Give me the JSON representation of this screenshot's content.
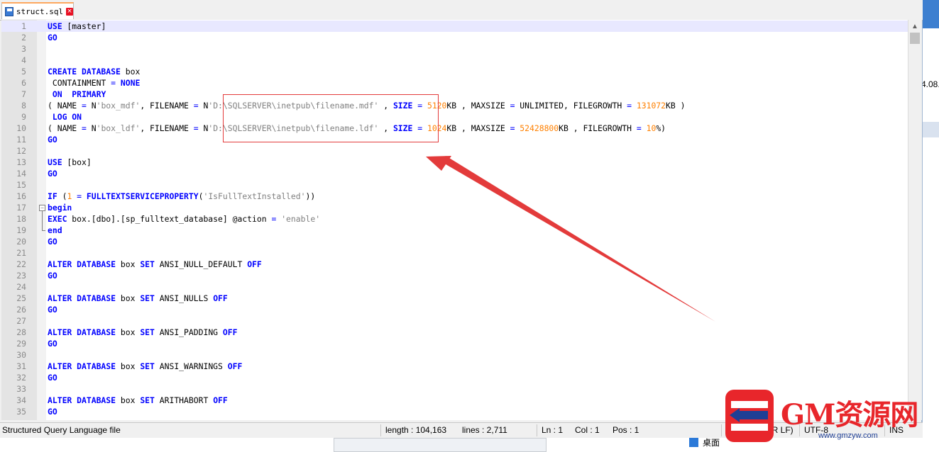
{
  "tab": {
    "title": "struct.sql",
    "close_symbol": "×"
  },
  "editor": {
    "lines": [
      {
        "n": "1",
        "cur": true,
        "parts": [
          [
            "k",
            "USE"
          ],
          [
            "v",
            " [master]"
          ]
        ]
      },
      {
        "n": "2",
        "parts": [
          [
            "k",
            "GO"
          ]
        ]
      },
      {
        "n": "3",
        "parts": []
      },
      {
        "n": "4",
        "parts": []
      },
      {
        "n": "5",
        "parts": [
          [
            "k",
            "CREATE DATABASE"
          ],
          [
            "v",
            " box"
          ]
        ]
      },
      {
        "n": "6",
        "parts": [
          [
            "v",
            " CONTAINMENT "
          ],
          [
            "o",
            "="
          ],
          [
            "v",
            " "
          ],
          [
            "k",
            "NONE"
          ]
        ]
      },
      {
        "n": "7",
        "parts": [
          [
            "v",
            " "
          ],
          [
            "k",
            "ON"
          ],
          [
            "v",
            "  "
          ],
          [
            "k",
            "PRIMARY"
          ]
        ]
      },
      {
        "n": "8",
        "parts": [
          [
            "v",
            "( NAME "
          ],
          [
            "o",
            "="
          ],
          [
            "v",
            " N"
          ],
          [
            "s",
            "'box_mdf'"
          ],
          [
            "v",
            ", FILENAME "
          ],
          [
            "o",
            "="
          ],
          [
            "v",
            " N"
          ],
          [
            "s",
            "'D:\\SQLSERVER\\inetpub\\filename.mdf'"
          ],
          [
            "v",
            " , "
          ],
          [
            "k",
            "SIZE"
          ],
          [
            "v",
            " "
          ],
          [
            "o",
            "="
          ],
          [
            "v",
            " "
          ],
          [
            "n",
            "5120"
          ],
          [
            "v",
            "KB , MAXSIZE "
          ],
          [
            "o",
            "="
          ],
          [
            "v",
            " UNLIMITED, FILEGROWTH "
          ],
          [
            "o",
            "="
          ],
          [
            "v",
            " "
          ],
          [
            "n",
            "131072"
          ],
          [
            "v",
            "KB )"
          ]
        ]
      },
      {
        "n": "9",
        "parts": [
          [
            "v",
            " "
          ],
          [
            "k",
            "LOG ON"
          ]
        ]
      },
      {
        "n": "10",
        "parts": [
          [
            "v",
            "( NAME "
          ],
          [
            "o",
            "="
          ],
          [
            "v",
            " N"
          ],
          [
            "s",
            "'box_ldf'"
          ],
          [
            "v",
            ", FILENAME "
          ],
          [
            "o",
            "="
          ],
          [
            "v",
            " N"
          ],
          [
            "s",
            "'D:\\SQLSERVER\\inetpub\\filename.ldf'"
          ],
          [
            "v",
            " , "
          ],
          [
            "k",
            "SIZE"
          ],
          [
            "v",
            " "
          ],
          [
            "o",
            "="
          ],
          [
            "v",
            " "
          ],
          [
            "n",
            "1024"
          ],
          [
            "v",
            "KB , MAXSIZE "
          ],
          [
            "o",
            "="
          ],
          [
            "v",
            " "
          ],
          [
            "n",
            "52428800"
          ],
          [
            "v",
            "KB , FILEGROWTH "
          ],
          [
            "o",
            "="
          ],
          [
            "v",
            " "
          ],
          [
            "n",
            "10"
          ],
          [
            "v",
            "%)"
          ]
        ]
      },
      {
        "n": "11",
        "parts": [
          [
            "k",
            "GO"
          ]
        ]
      },
      {
        "n": "12",
        "parts": []
      },
      {
        "n": "13",
        "parts": [
          [
            "k",
            "USE"
          ],
          [
            "v",
            " [box]"
          ]
        ]
      },
      {
        "n": "14",
        "parts": [
          [
            "k",
            "GO"
          ]
        ]
      },
      {
        "n": "15",
        "parts": []
      },
      {
        "n": "16",
        "parts": [
          [
            "k",
            "IF"
          ],
          [
            "v",
            " ("
          ],
          [
            "n",
            "1"
          ],
          [
            "v",
            " "
          ],
          [
            "o",
            "="
          ],
          [
            "v",
            " "
          ],
          [
            "f",
            "FULLTEXTSERVICEPROPERTY"
          ],
          [
            "v",
            "("
          ],
          [
            "s",
            "'IsFullTextInstalled'"
          ],
          [
            "v",
            "))"
          ]
        ]
      },
      {
        "n": "17",
        "parts": [
          [
            "k",
            "begin"
          ]
        ]
      },
      {
        "n": "18",
        "parts": [
          [
            "k",
            "EXEC"
          ],
          [
            "v",
            " box.[dbo].[sp_fulltext_database] @action "
          ],
          [
            "o",
            "="
          ],
          [
            "v",
            " "
          ],
          [
            "s",
            "'enable'"
          ]
        ]
      },
      {
        "n": "19",
        "parts": [
          [
            "k",
            "end"
          ]
        ]
      },
      {
        "n": "20",
        "parts": [
          [
            "k",
            "GO"
          ]
        ]
      },
      {
        "n": "21",
        "parts": []
      },
      {
        "n": "22",
        "parts": [
          [
            "k",
            "ALTER DATABASE"
          ],
          [
            "v",
            " box "
          ],
          [
            "k",
            "SET"
          ],
          [
            "v",
            " ANSI_NULL_DEFAULT "
          ],
          [
            "k",
            "OFF"
          ]
        ]
      },
      {
        "n": "23",
        "parts": [
          [
            "k",
            "GO"
          ]
        ]
      },
      {
        "n": "24",
        "parts": []
      },
      {
        "n": "25",
        "parts": [
          [
            "k",
            "ALTER DATABASE"
          ],
          [
            "v",
            " box "
          ],
          [
            "k",
            "SET"
          ],
          [
            "v",
            " ANSI_NULLS "
          ],
          [
            "k",
            "OFF"
          ]
        ]
      },
      {
        "n": "26",
        "parts": [
          [
            "k",
            "GO"
          ]
        ]
      },
      {
        "n": "27",
        "parts": []
      },
      {
        "n": "28",
        "parts": [
          [
            "k",
            "ALTER DATABASE"
          ],
          [
            "v",
            " box "
          ],
          [
            "k",
            "SET"
          ],
          [
            "v",
            " ANSI_PADDING "
          ],
          [
            "k",
            "OFF"
          ]
        ]
      },
      {
        "n": "29",
        "parts": [
          [
            "k",
            "GO"
          ]
        ]
      },
      {
        "n": "30",
        "parts": []
      },
      {
        "n": "31",
        "parts": [
          [
            "k",
            "ALTER DATABASE"
          ],
          [
            "v",
            " box "
          ],
          [
            "k",
            "SET"
          ],
          [
            "v",
            " ANSI_WARNINGS "
          ],
          [
            "k",
            "OFF"
          ]
        ]
      },
      {
        "n": "32",
        "parts": [
          [
            "k",
            "GO"
          ]
        ]
      },
      {
        "n": "33",
        "parts": []
      },
      {
        "n": "34",
        "parts": [
          [
            "k",
            "ALTER DATABASE"
          ],
          [
            "v",
            " box "
          ],
          [
            "k",
            "SET"
          ],
          [
            "v",
            " ARITHABORT "
          ],
          [
            "k",
            "OFF"
          ]
        ]
      },
      {
        "n": "35",
        "parts": [
          [
            "k",
            "GO"
          ]
        ]
      }
    ]
  },
  "statusbar": {
    "filetype": "Structured Query Language file",
    "length": "length : 104,163",
    "lines": "lines : 2,711",
    "ln": "Ln : 1",
    "col": "Col : 1",
    "pos": "Pos : 1",
    "eol": "Windows (CR LF)",
    "encoding": "UTF-8",
    "mode": "INS"
  },
  "background": {
    "right_number": "4.08.",
    "desktop_label": "桌面"
  },
  "watermark": {
    "text": "GM资源网",
    "url": "www.gmzyw.com"
  },
  "colors": {
    "keyword": "#0000ff",
    "string": "#808080",
    "number": "#ff8000",
    "annotation": "#e33b3b",
    "tab_accent": "#fda85f"
  },
  "icons": [
    "save-icon",
    "close-icon",
    "fold-minus-icon",
    "scroll-up-arrow-icon",
    "annotation-arrow",
    "gm-logo-icon"
  ]
}
